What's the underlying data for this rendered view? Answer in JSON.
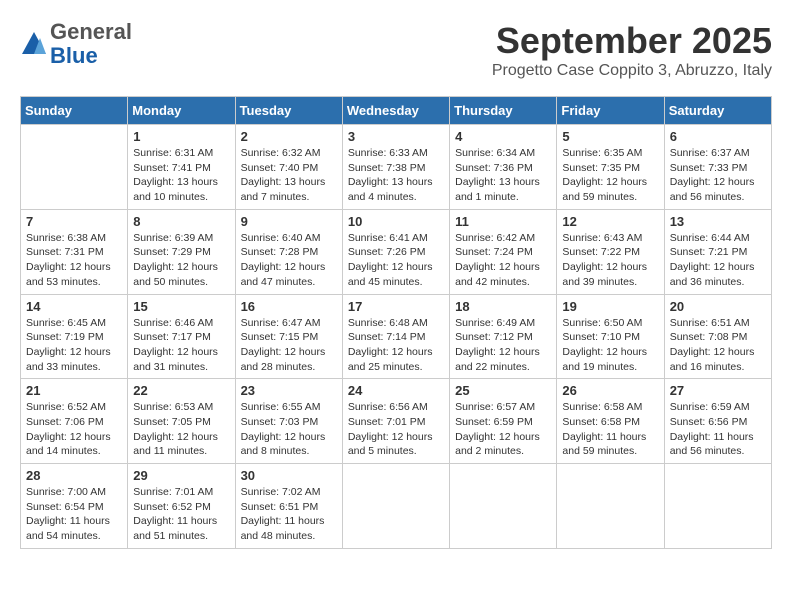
{
  "header": {
    "logo_general": "General",
    "logo_blue": "Blue",
    "month_title": "September 2025",
    "location": "Progetto Case Coppito 3, Abruzzo, Italy"
  },
  "weekdays": [
    "Sunday",
    "Monday",
    "Tuesday",
    "Wednesday",
    "Thursday",
    "Friday",
    "Saturday"
  ],
  "weeks": [
    [
      {
        "day": "",
        "sunrise": "",
        "sunset": "",
        "daylight": ""
      },
      {
        "day": "1",
        "sunrise": "Sunrise: 6:31 AM",
        "sunset": "Sunset: 7:41 PM",
        "daylight": "Daylight: 13 hours and 10 minutes."
      },
      {
        "day": "2",
        "sunrise": "Sunrise: 6:32 AM",
        "sunset": "Sunset: 7:40 PM",
        "daylight": "Daylight: 13 hours and 7 minutes."
      },
      {
        "day": "3",
        "sunrise": "Sunrise: 6:33 AM",
        "sunset": "Sunset: 7:38 PM",
        "daylight": "Daylight: 13 hours and 4 minutes."
      },
      {
        "day": "4",
        "sunrise": "Sunrise: 6:34 AM",
        "sunset": "Sunset: 7:36 PM",
        "daylight": "Daylight: 13 hours and 1 minute."
      },
      {
        "day": "5",
        "sunrise": "Sunrise: 6:35 AM",
        "sunset": "Sunset: 7:35 PM",
        "daylight": "Daylight: 12 hours and 59 minutes."
      },
      {
        "day": "6",
        "sunrise": "Sunrise: 6:37 AM",
        "sunset": "Sunset: 7:33 PM",
        "daylight": "Daylight: 12 hours and 56 minutes."
      }
    ],
    [
      {
        "day": "7",
        "sunrise": "Sunrise: 6:38 AM",
        "sunset": "Sunset: 7:31 PM",
        "daylight": "Daylight: 12 hours and 53 minutes."
      },
      {
        "day": "8",
        "sunrise": "Sunrise: 6:39 AM",
        "sunset": "Sunset: 7:29 PM",
        "daylight": "Daylight: 12 hours and 50 minutes."
      },
      {
        "day": "9",
        "sunrise": "Sunrise: 6:40 AM",
        "sunset": "Sunset: 7:28 PM",
        "daylight": "Daylight: 12 hours and 47 minutes."
      },
      {
        "day": "10",
        "sunrise": "Sunrise: 6:41 AM",
        "sunset": "Sunset: 7:26 PM",
        "daylight": "Daylight: 12 hours and 45 minutes."
      },
      {
        "day": "11",
        "sunrise": "Sunrise: 6:42 AM",
        "sunset": "Sunset: 7:24 PM",
        "daylight": "Daylight: 12 hours and 42 minutes."
      },
      {
        "day": "12",
        "sunrise": "Sunrise: 6:43 AM",
        "sunset": "Sunset: 7:22 PM",
        "daylight": "Daylight: 12 hours and 39 minutes."
      },
      {
        "day": "13",
        "sunrise": "Sunrise: 6:44 AM",
        "sunset": "Sunset: 7:21 PM",
        "daylight": "Daylight: 12 hours and 36 minutes."
      }
    ],
    [
      {
        "day": "14",
        "sunrise": "Sunrise: 6:45 AM",
        "sunset": "Sunset: 7:19 PM",
        "daylight": "Daylight: 12 hours and 33 minutes."
      },
      {
        "day": "15",
        "sunrise": "Sunrise: 6:46 AM",
        "sunset": "Sunset: 7:17 PM",
        "daylight": "Daylight: 12 hours and 31 minutes."
      },
      {
        "day": "16",
        "sunrise": "Sunrise: 6:47 AM",
        "sunset": "Sunset: 7:15 PM",
        "daylight": "Daylight: 12 hours and 28 minutes."
      },
      {
        "day": "17",
        "sunrise": "Sunrise: 6:48 AM",
        "sunset": "Sunset: 7:14 PM",
        "daylight": "Daylight: 12 hours and 25 minutes."
      },
      {
        "day": "18",
        "sunrise": "Sunrise: 6:49 AM",
        "sunset": "Sunset: 7:12 PM",
        "daylight": "Daylight: 12 hours and 22 minutes."
      },
      {
        "day": "19",
        "sunrise": "Sunrise: 6:50 AM",
        "sunset": "Sunset: 7:10 PM",
        "daylight": "Daylight: 12 hours and 19 minutes."
      },
      {
        "day": "20",
        "sunrise": "Sunrise: 6:51 AM",
        "sunset": "Sunset: 7:08 PM",
        "daylight": "Daylight: 12 hours and 16 minutes."
      }
    ],
    [
      {
        "day": "21",
        "sunrise": "Sunrise: 6:52 AM",
        "sunset": "Sunset: 7:06 PM",
        "daylight": "Daylight: 12 hours and 14 minutes."
      },
      {
        "day": "22",
        "sunrise": "Sunrise: 6:53 AM",
        "sunset": "Sunset: 7:05 PM",
        "daylight": "Daylight: 12 hours and 11 minutes."
      },
      {
        "day": "23",
        "sunrise": "Sunrise: 6:55 AM",
        "sunset": "Sunset: 7:03 PM",
        "daylight": "Daylight: 12 hours and 8 minutes."
      },
      {
        "day": "24",
        "sunrise": "Sunrise: 6:56 AM",
        "sunset": "Sunset: 7:01 PM",
        "daylight": "Daylight: 12 hours and 5 minutes."
      },
      {
        "day": "25",
        "sunrise": "Sunrise: 6:57 AM",
        "sunset": "Sunset: 6:59 PM",
        "daylight": "Daylight: 12 hours and 2 minutes."
      },
      {
        "day": "26",
        "sunrise": "Sunrise: 6:58 AM",
        "sunset": "Sunset: 6:58 PM",
        "daylight": "Daylight: 11 hours and 59 minutes."
      },
      {
        "day": "27",
        "sunrise": "Sunrise: 6:59 AM",
        "sunset": "Sunset: 6:56 PM",
        "daylight": "Daylight: 11 hours and 56 minutes."
      }
    ],
    [
      {
        "day": "28",
        "sunrise": "Sunrise: 7:00 AM",
        "sunset": "Sunset: 6:54 PM",
        "daylight": "Daylight: 11 hours and 54 minutes."
      },
      {
        "day": "29",
        "sunrise": "Sunrise: 7:01 AM",
        "sunset": "Sunset: 6:52 PM",
        "daylight": "Daylight: 11 hours and 51 minutes."
      },
      {
        "day": "30",
        "sunrise": "Sunrise: 7:02 AM",
        "sunset": "Sunset: 6:51 PM",
        "daylight": "Daylight: 11 hours and 48 minutes."
      },
      {
        "day": "",
        "sunrise": "",
        "sunset": "",
        "daylight": ""
      },
      {
        "day": "",
        "sunrise": "",
        "sunset": "",
        "daylight": ""
      },
      {
        "day": "",
        "sunrise": "",
        "sunset": "",
        "daylight": ""
      },
      {
        "day": "",
        "sunrise": "",
        "sunset": "",
        "daylight": ""
      }
    ]
  ]
}
